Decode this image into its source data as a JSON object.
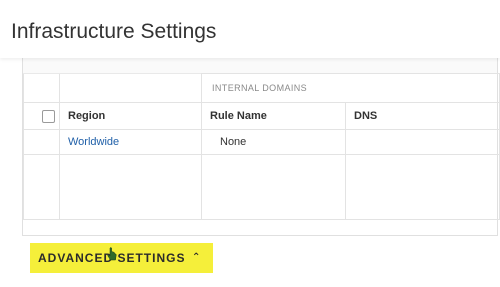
{
  "header": {
    "title": "Infrastructure Settings"
  },
  "table": {
    "group_header": "INTERNAL DOMAINS",
    "columns": [
      "Region",
      "Rule Name",
      "DNS"
    ],
    "rows": [
      {
        "region": "Worldwide",
        "rule_name": "None",
        "dns": ""
      }
    ]
  },
  "advanced_settings": {
    "label": "ADVANCED SETTINGS",
    "icon": "chevron-up-icon",
    "highlight_color": "#f5ef3a"
  },
  "colors": {
    "link": "#1f5fa8",
    "text": "#333333",
    "border": "#e3e3e3"
  }
}
